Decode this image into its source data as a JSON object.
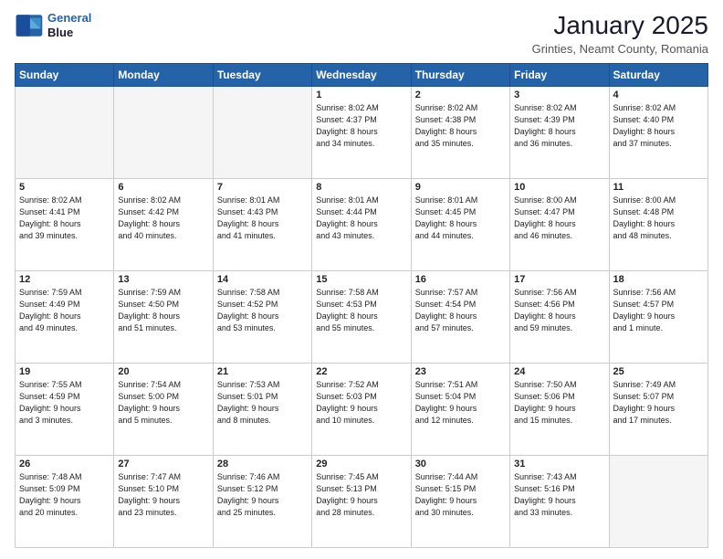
{
  "header": {
    "logo_line1": "General",
    "logo_line2": "Blue",
    "month": "January 2025",
    "location": "Grinties, Neamt County, Romania"
  },
  "days_of_week": [
    "Sunday",
    "Monday",
    "Tuesday",
    "Wednesday",
    "Thursday",
    "Friday",
    "Saturday"
  ],
  "weeks": [
    [
      {
        "num": "",
        "info": ""
      },
      {
        "num": "",
        "info": ""
      },
      {
        "num": "",
        "info": ""
      },
      {
        "num": "1",
        "info": "Sunrise: 8:02 AM\nSunset: 4:37 PM\nDaylight: 8 hours\nand 34 minutes."
      },
      {
        "num": "2",
        "info": "Sunrise: 8:02 AM\nSunset: 4:38 PM\nDaylight: 8 hours\nand 35 minutes."
      },
      {
        "num": "3",
        "info": "Sunrise: 8:02 AM\nSunset: 4:39 PM\nDaylight: 8 hours\nand 36 minutes."
      },
      {
        "num": "4",
        "info": "Sunrise: 8:02 AM\nSunset: 4:40 PM\nDaylight: 8 hours\nand 37 minutes."
      }
    ],
    [
      {
        "num": "5",
        "info": "Sunrise: 8:02 AM\nSunset: 4:41 PM\nDaylight: 8 hours\nand 39 minutes."
      },
      {
        "num": "6",
        "info": "Sunrise: 8:02 AM\nSunset: 4:42 PM\nDaylight: 8 hours\nand 40 minutes."
      },
      {
        "num": "7",
        "info": "Sunrise: 8:01 AM\nSunset: 4:43 PM\nDaylight: 8 hours\nand 41 minutes."
      },
      {
        "num": "8",
        "info": "Sunrise: 8:01 AM\nSunset: 4:44 PM\nDaylight: 8 hours\nand 43 minutes."
      },
      {
        "num": "9",
        "info": "Sunrise: 8:01 AM\nSunset: 4:45 PM\nDaylight: 8 hours\nand 44 minutes."
      },
      {
        "num": "10",
        "info": "Sunrise: 8:00 AM\nSunset: 4:47 PM\nDaylight: 8 hours\nand 46 minutes."
      },
      {
        "num": "11",
        "info": "Sunrise: 8:00 AM\nSunset: 4:48 PM\nDaylight: 8 hours\nand 48 minutes."
      }
    ],
    [
      {
        "num": "12",
        "info": "Sunrise: 7:59 AM\nSunset: 4:49 PM\nDaylight: 8 hours\nand 49 minutes."
      },
      {
        "num": "13",
        "info": "Sunrise: 7:59 AM\nSunset: 4:50 PM\nDaylight: 8 hours\nand 51 minutes."
      },
      {
        "num": "14",
        "info": "Sunrise: 7:58 AM\nSunset: 4:52 PM\nDaylight: 8 hours\nand 53 minutes."
      },
      {
        "num": "15",
        "info": "Sunrise: 7:58 AM\nSunset: 4:53 PM\nDaylight: 8 hours\nand 55 minutes."
      },
      {
        "num": "16",
        "info": "Sunrise: 7:57 AM\nSunset: 4:54 PM\nDaylight: 8 hours\nand 57 minutes."
      },
      {
        "num": "17",
        "info": "Sunrise: 7:56 AM\nSunset: 4:56 PM\nDaylight: 8 hours\nand 59 minutes."
      },
      {
        "num": "18",
        "info": "Sunrise: 7:56 AM\nSunset: 4:57 PM\nDaylight: 9 hours\nand 1 minute."
      }
    ],
    [
      {
        "num": "19",
        "info": "Sunrise: 7:55 AM\nSunset: 4:59 PM\nDaylight: 9 hours\nand 3 minutes."
      },
      {
        "num": "20",
        "info": "Sunrise: 7:54 AM\nSunset: 5:00 PM\nDaylight: 9 hours\nand 5 minutes."
      },
      {
        "num": "21",
        "info": "Sunrise: 7:53 AM\nSunset: 5:01 PM\nDaylight: 9 hours\nand 8 minutes."
      },
      {
        "num": "22",
        "info": "Sunrise: 7:52 AM\nSunset: 5:03 PM\nDaylight: 9 hours\nand 10 minutes."
      },
      {
        "num": "23",
        "info": "Sunrise: 7:51 AM\nSunset: 5:04 PM\nDaylight: 9 hours\nand 12 minutes."
      },
      {
        "num": "24",
        "info": "Sunrise: 7:50 AM\nSunset: 5:06 PM\nDaylight: 9 hours\nand 15 minutes."
      },
      {
        "num": "25",
        "info": "Sunrise: 7:49 AM\nSunset: 5:07 PM\nDaylight: 9 hours\nand 17 minutes."
      }
    ],
    [
      {
        "num": "26",
        "info": "Sunrise: 7:48 AM\nSunset: 5:09 PM\nDaylight: 9 hours\nand 20 minutes."
      },
      {
        "num": "27",
        "info": "Sunrise: 7:47 AM\nSunset: 5:10 PM\nDaylight: 9 hours\nand 23 minutes."
      },
      {
        "num": "28",
        "info": "Sunrise: 7:46 AM\nSunset: 5:12 PM\nDaylight: 9 hours\nand 25 minutes."
      },
      {
        "num": "29",
        "info": "Sunrise: 7:45 AM\nSunset: 5:13 PM\nDaylight: 9 hours\nand 28 minutes."
      },
      {
        "num": "30",
        "info": "Sunrise: 7:44 AM\nSunset: 5:15 PM\nDaylight: 9 hours\nand 30 minutes."
      },
      {
        "num": "31",
        "info": "Sunrise: 7:43 AM\nSunset: 5:16 PM\nDaylight: 9 hours\nand 33 minutes."
      },
      {
        "num": "",
        "info": ""
      }
    ]
  ]
}
